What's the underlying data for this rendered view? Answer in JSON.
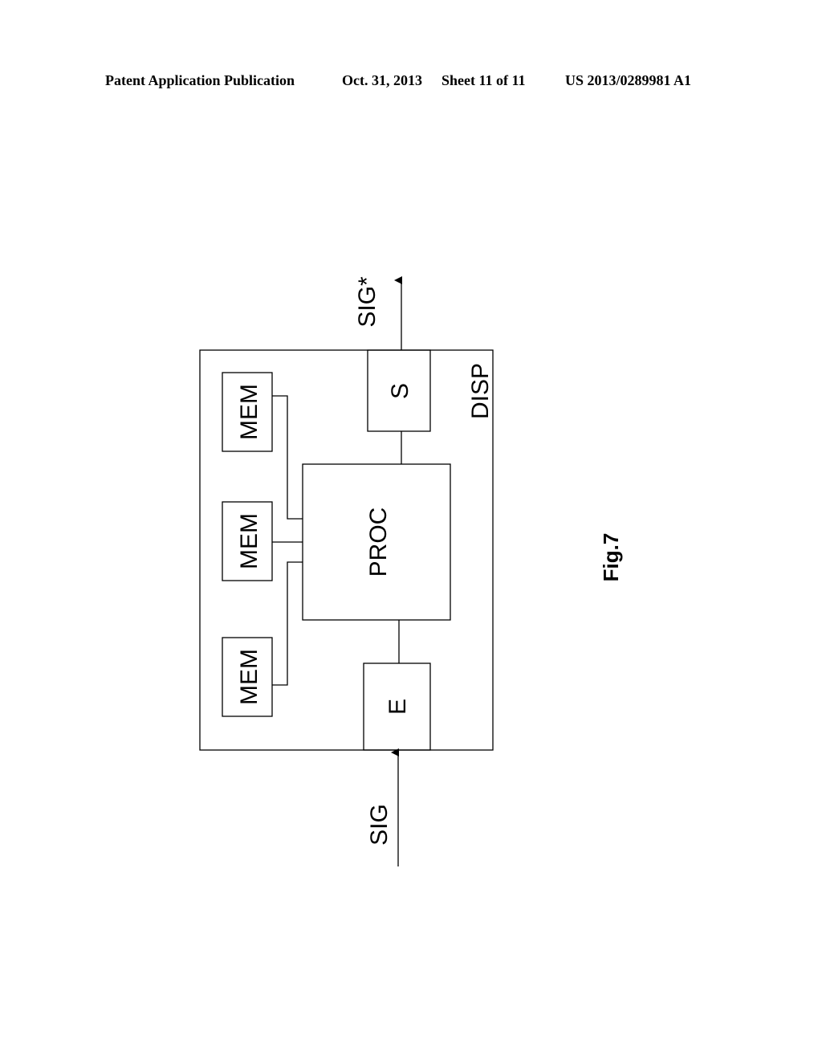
{
  "header": {
    "publication": "Patent Application Publication",
    "date": "Oct. 31, 2013",
    "sheet": "Sheet 11 of 11",
    "number": "US 2013/0289981 A1"
  },
  "diagram": {
    "container_label": "DISP",
    "processor_label": "PROC",
    "memory_labels": [
      "MEM",
      "MEM",
      "MEM"
    ],
    "input_block_label": "E",
    "output_block_label": "S",
    "input_signal_label": "SIG",
    "output_signal_label": "SIG*",
    "figure_label": "Fig.7"
  }
}
